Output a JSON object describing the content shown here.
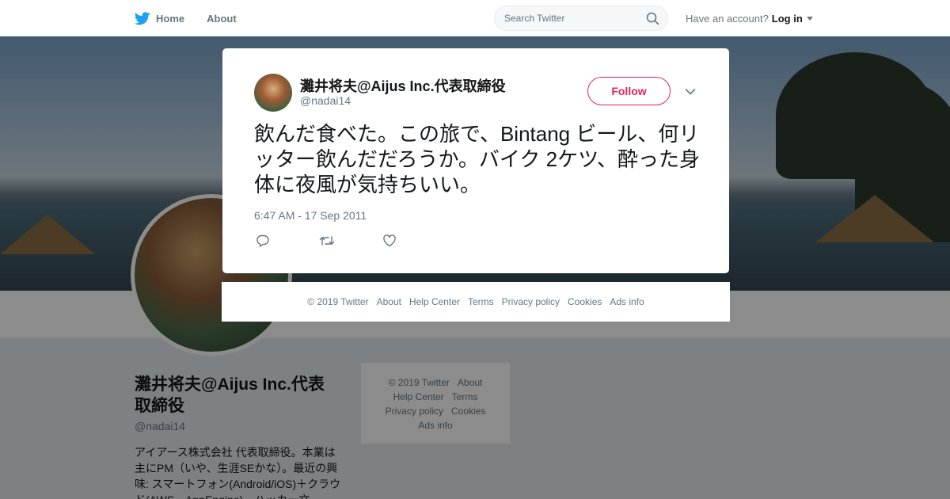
{
  "nav": {
    "home": "Home",
    "about": "About",
    "search_placeholder": "Search Twitter",
    "have_account": "Have an account?",
    "login": "Log in"
  },
  "profile": {
    "name": "灘井将夫@Aijus Inc.代表取締役",
    "handle": "@nadai14",
    "bio": "アイアース株式会社 代表取締役。本業は主にPM（いや、生涯SEかな）。最近の興味: スマートフォン(Android/iOS)＋クラウド(AWS、AppEngine)、ハッカー文"
  },
  "side_footer": {
    "copyright": "© 2019 Twitter",
    "about": "About",
    "help": "Help Center",
    "terms": "Terms",
    "privacy": "Privacy policy",
    "cookies": "Cookies",
    "ads": "Ads info"
  },
  "tweet": {
    "author_name": "灘井将夫@Aijus Inc.代表取締役",
    "author_handle": "@nadai14",
    "follow_label": "Follow",
    "text": "飲んだ食べた。この旅で、Bintang ビール、何リッター飲んだだろうか。バイク 2ケツ、酔った身体に夜風が気持ちいい。",
    "timestamp": "6:47 AM - 17 Sep 2011"
  },
  "footer": {
    "copyright": "© 2019 Twitter",
    "about": "About",
    "help": "Help Center",
    "terms": "Terms",
    "privacy": "Privacy policy",
    "cookies": "Cookies",
    "ads": "Ads info"
  },
  "colors": {
    "twitter_blue": "#1da1f2",
    "follow_red": "#e0245e",
    "muted": "#657786"
  },
  "icons": [
    "twitter-bird-icon",
    "search-icon",
    "close-icon",
    "chevron-down-icon",
    "reply-icon",
    "retweet-icon",
    "like-icon"
  ]
}
